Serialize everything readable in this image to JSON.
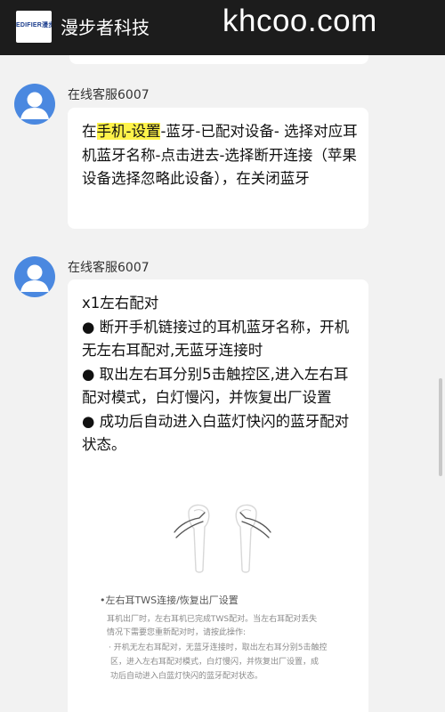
{
  "header": {
    "logo_text": "EDIFIER漫步者",
    "app_title": "漫步者科技",
    "watermark": "khcoo.com"
  },
  "messages": [
    {
      "sender": "在线客服6007",
      "text_parts": [
        "在",
        "手机-设置",
        "-蓝牙-已配对设备- 选择对应耳机蓝牙名称-点击进去-选择断开连接（苹果设备选择忽略此设备），在关闭蓝牙"
      ]
    },
    {
      "sender": "在线客服6007",
      "lines": [
        "x1左右配对",
        "● 断开手机链接过的耳机蓝牙名称，开机无左右耳配对,无蓝牙连接时",
        "● 取出左右耳分别5击触控区,进入左右耳配对模式，白灯慢闪，并恢复出厂设置",
        "● 成功后自动进入白蓝灯快闪的蓝牙配对状态。"
      ],
      "image_caption": {
        "title": "•左右耳TWS连接/恢复出厂设置",
        "lines": [
          "耳机出厂时，左右耳机已完成TWS配对。当左右耳配对丢失",
          "情况下需要您重新配对时，请按此操作:",
          "·  开机无左右耳配对，无蓝牙连接时，取出左右耳分别5击触控",
          "区，进入左右耳配对模式，白灯慢闪，并恢复出厂设置，成",
          "功后自动进入白蓝灯快闪的蓝牙配对状态。"
        ]
      }
    }
  ],
  "colors": {
    "header_bg": "#1c1c1c",
    "page_bg": "#f2f2f2",
    "avatar": "#4a88e0",
    "highlight": "#fff34a"
  }
}
